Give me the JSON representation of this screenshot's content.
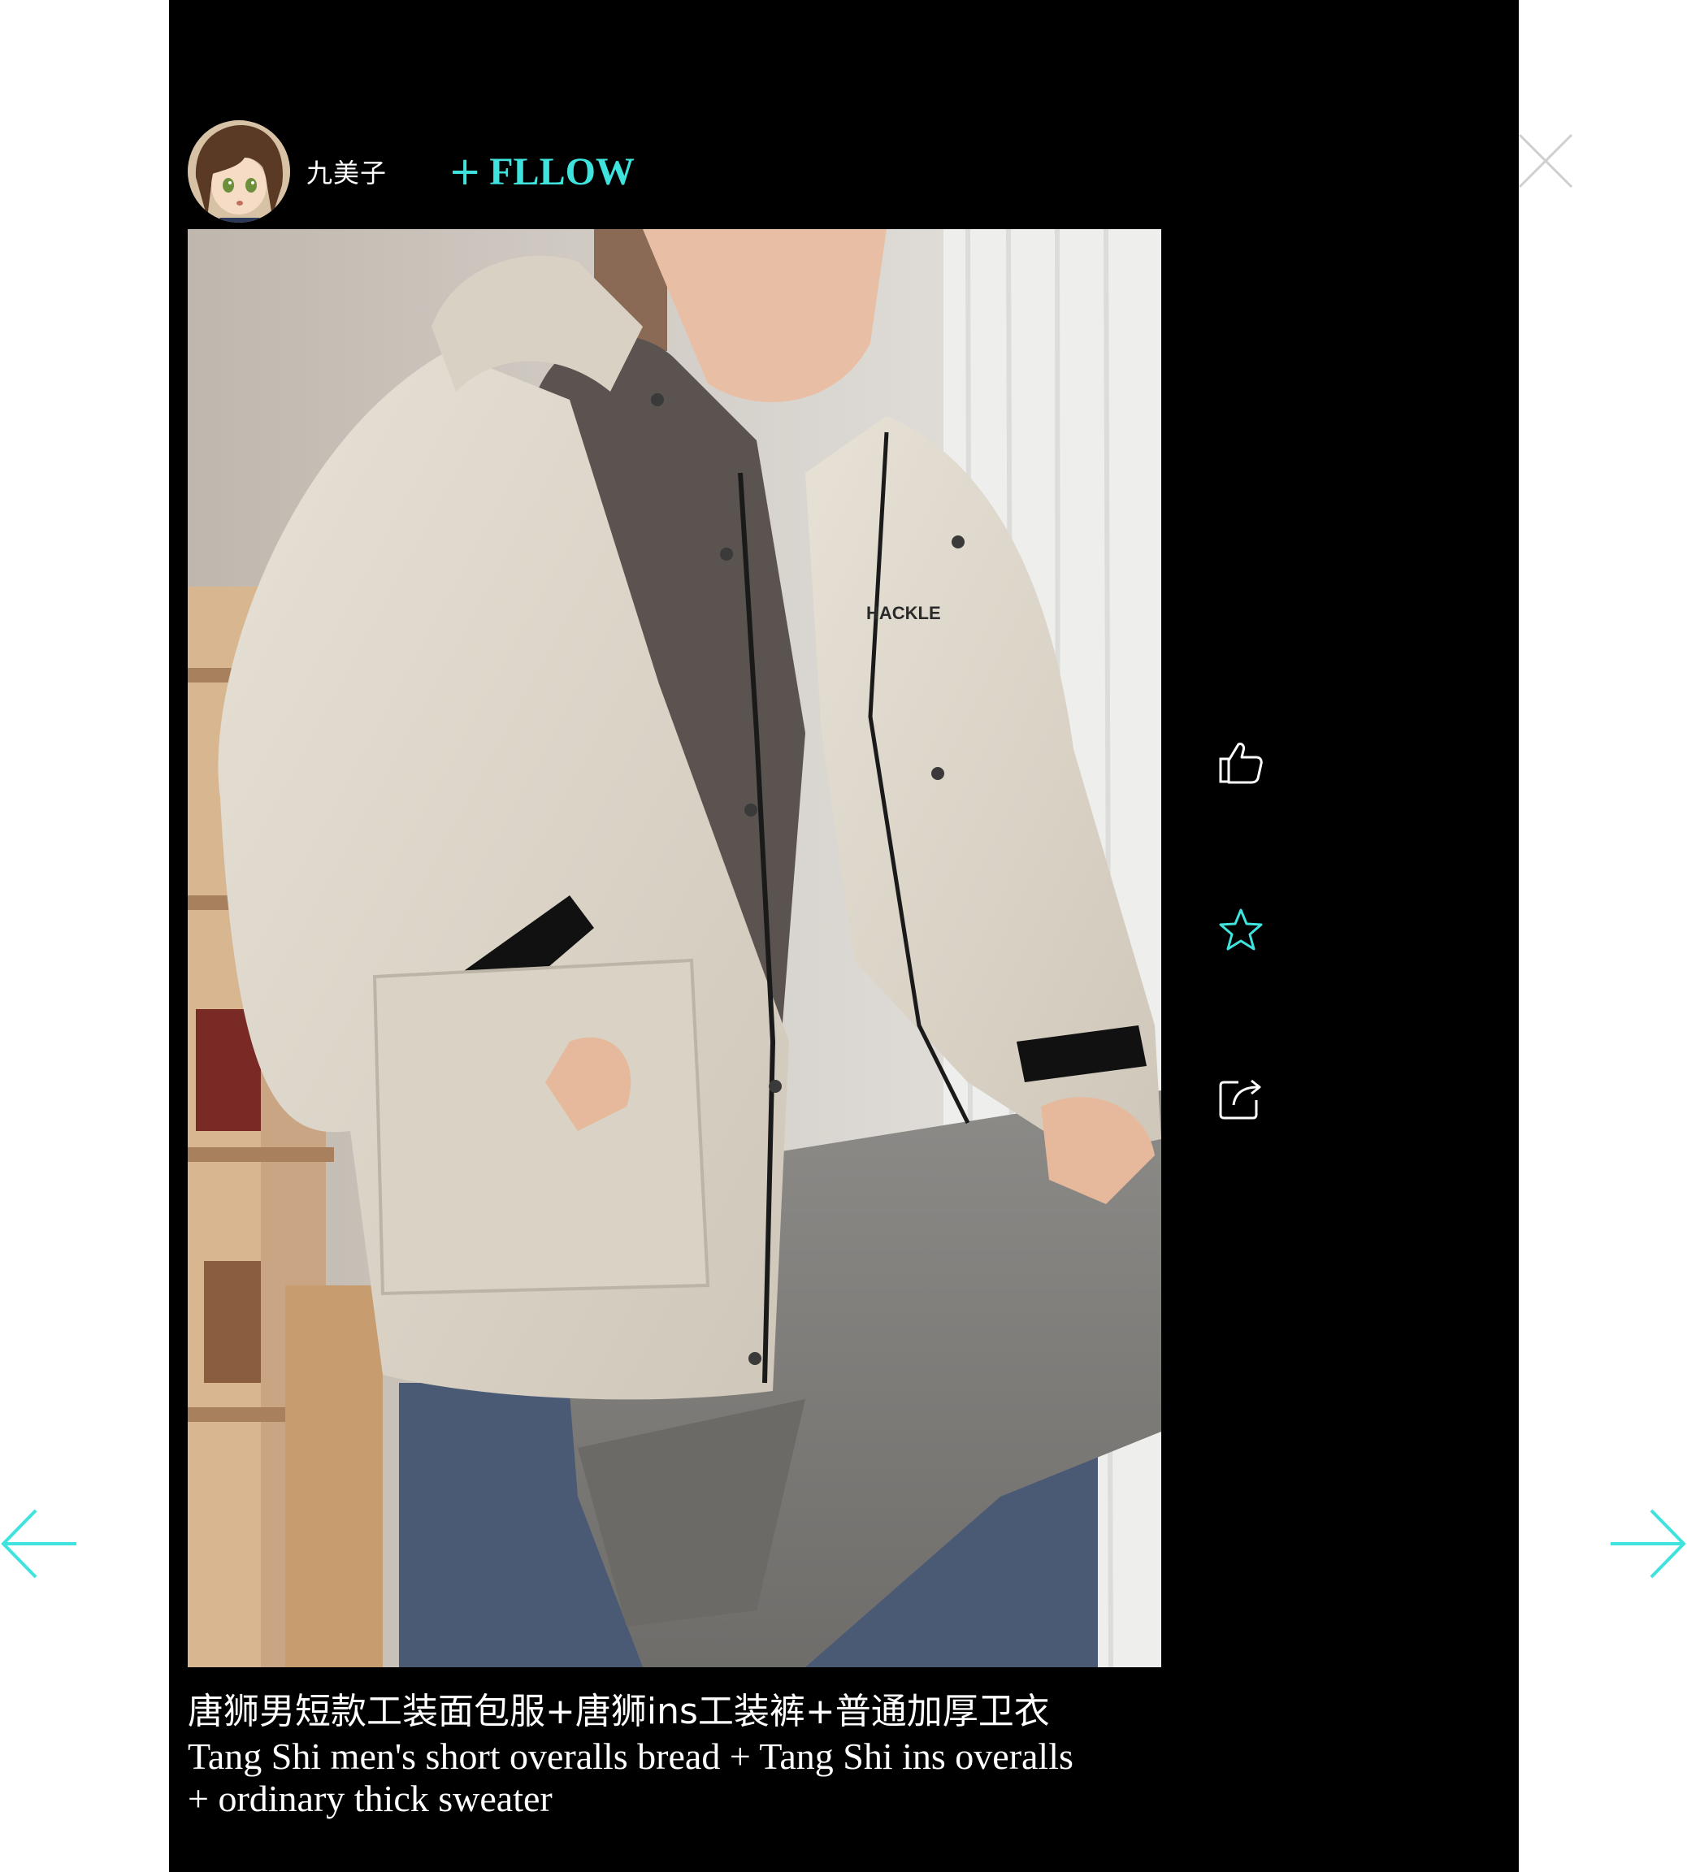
{
  "post": {
    "author": {
      "name": "九美子",
      "avatar_icon": "anime-avatar"
    },
    "follow_label": "FLLOW",
    "follow_plus": "+",
    "photo_text": "HACKLE",
    "caption_zh": "唐狮男短款工装面包服+唐狮ins工装裤+普通加厚卫衣",
    "caption_en": "Tang Shi men's short overalls bread + Tang Shi ins overalls + ordinary thick sweater"
  },
  "actions": [
    {
      "name": "like",
      "icon": "thumbs-up-icon"
    },
    {
      "name": "favorite",
      "icon": "star-icon"
    },
    {
      "name": "share",
      "icon": "share-icon"
    }
  ],
  "controls": {
    "close_icon": "close-icon",
    "prev_icon": "arrow-left-icon",
    "next_icon": "arrow-right-icon"
  },
  "colors": {
    "modal_bg": "#000000",
    "page_bg": "#ffffff",
    "accent": "#3fe3dd",
    "text": "#ffffff",
    "icon": "#ffffff"
  }
}
